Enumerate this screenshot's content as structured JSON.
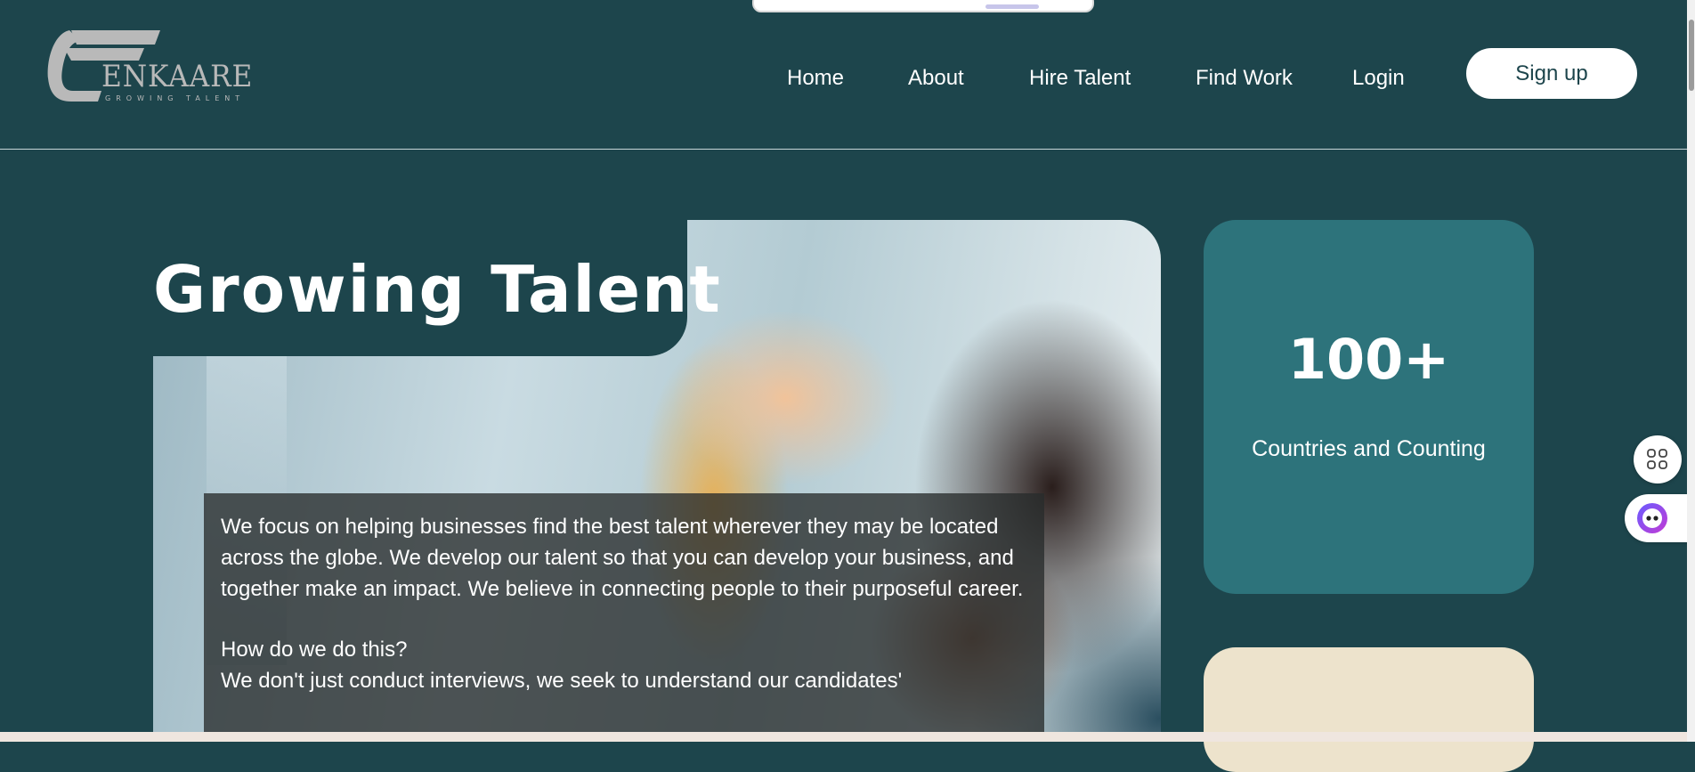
{
  "header": {
    "logo": {
      "wordmark": "ENKAARE",
      "tagline": "GROWING TALENT"
    },
    "nav": [
      {
        "label": "Home"
      },
      {
        "label": "About"
      },
      {
        "label": "Hire Talent"
      },
      {
        "label": "Find Work"
      },
      {
        "label": "Login"
      }
    ],
    "signup_label": "Sign up"
  },
  "hero": {
    "title": "Growing Talent",
    "paragraph_1": "We focus on helping businesses find the best talent wherever they may be located across the globe. We develop our talent so that you can develop your business, and together make an impact. We believe in connecting people to their purposeful career.",
    "question": "How do we do this?",
    "paragraph_2": "We don't just conduct interviews, we seek to understand our candidates'"
  },
  "stats": {
    "value": "100+",
    "label": "Countries and Counting"
  },
  "widgets": {
    "apps_icon": "apps-grid-icon",
    "chat_icon": "chat-bot-icon"
  },
  "colors": {
    "background": "#1d454c",
    "stat_card": "#2d737b",
    "cream_card": "#ede3cc",
    "text_box": "#282c2c"
  }
}
